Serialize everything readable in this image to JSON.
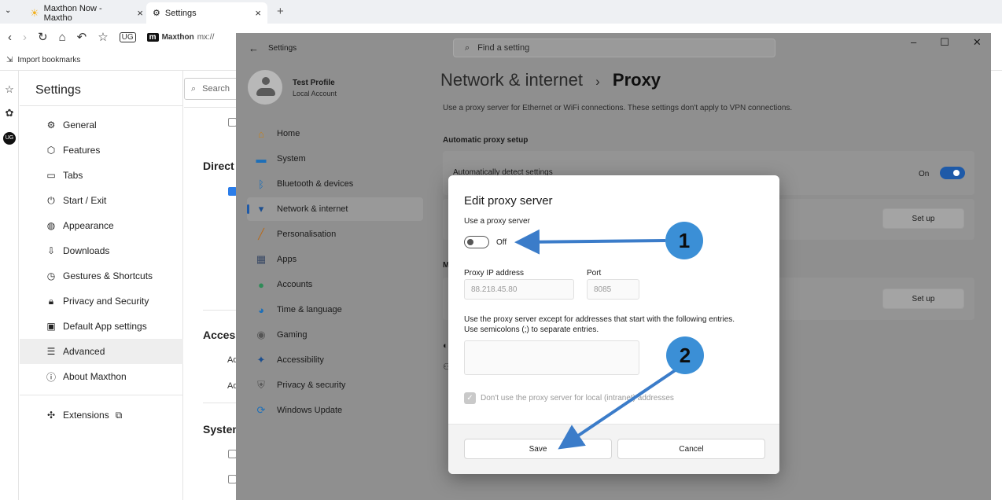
{
  "browser": {
    "tabs": [
      {
        "title": "Maxthon Now - Maxtho",
        "close": "×"
      },
      {
        "title": "Settings",
        "close": "×"
      }
    ],
    "new_tab": "+",
    "address_brand": "Maxthon",
    "address_url": "mx://",
    "bookmarks_import": "Import bookmarks"
  },
  "maxthon": {
    "title": "Settings",
    "search_placeholder": "Search",
    "nav": [
      {
        "label": "General",
        "icon": "gear-icon"
      },
      {
        "label": "Features",
        "icon": "cube-icon"
      },
      {
        "label": "Tabs",
        "icon": "tab-icon"
      },
      {
        "label": "Start / Exit",
        "icon": "power-icon"
      },
      {
        "label": "Appearance",
        "icon": "palette-icon"
      },
      {
        "label": "Downloads",
        "icon": "download-icon"
      },
      {
        "label": "Gestures & Shortcuts",
        "icon": "gesture-icon"
      },
      {
        "label": "Privacy and Security",
        "icon": "lock-icon"
      },
      {
        "label": "Default App settings",
        "icon": "app-icon"
      },
      {
        "label": "Advanced",
        "icon": "sliders-icon"
      },
      {
        "label": "About Maxthon",
        "icon": "info-icon"
      }
    ],
    "extensions_label": "Extensions",
    "main": {
      "heading_direct": "Direct",
      "heading_access": "Access",
      "heading_system": "System",
      "access_row1": "Ad",
      "access_row2": "Ad"
    }
  },
  "windows": {
    "window_title": "Settings",
    "search_placeholder": "Find a setting",
    "profile_name": "Test Profile",
    "profile_sub": "Local Account",
    "nav": [
      {
        "label": "Home",
        "icon": "home-icon"
      },
      {
        "label": "System",
        "icon": "monitor-icon"
      },
      {
        "label": "Bluetooth & devices",
        "icon": "bluetooth-icon"
      },
      {
        "label": "Network & internet",
        "icon": "wifi-icon"
      },
      {
        "label": "Personalisation",
        "icon": "brush-icon"
      },
      {
        "label": "Apps",
        "icon": "apps-icon"
      },
      {
        "label": "Accounts",
        "icon": "person-icon"
      },
      {
        "label": "Time & language",
        "icon": "globe-icon"
      },
      {
        "label": "Gaming",
        "icon": "gamepad-icon"
      },
      {
        "label": "Accessibility",
        "icon": "accessibility-icon"
      },
      {
        "label": "Privacy & security",
        "icon": "shield-icon"
      },
      {
        "label": "Windows Update",
        "icon": "update-icon"
      }
    ],
    "crumb_parent": "Network & internet",
    "crumb_sep": "›",
    "crumb_current": "Proxy",
    "description": "Use a proxy server for Ethernet or WiFi connections. These settings don't apply to VPN connections.",
    "auto_heading": "Automatic proxy setup",
    "auto_detect_label": "Automatically detect settings",
    "auto_detect_state": "On",
    "setup_label_1": "Set up",
    "setup_label_2": "Set up",
    "manual_heading_partial": "M"
  },
  "dialog": {
    "title": "Edit proxy server",
    "use_proxy_label": "Use a proxy server",
    "toggle_state": "Off",
    "ip_label": "Proxy IP address",
    "ip_value": "88.218.45.80",
    "port_label": "Port",
    "port_value": "8085",
    "except_text_1": "Use the proxy server except for addresses that start with the following entries.",
    "except_text_2": "Use semicolons (;) to separate entries.",
    "except_value": "",
    "local_checkbox_label": "Don't use the proxy server for local (intranet) addresses",
    "save_label": "Save",
    "cancel_label": "Cancel"
  },
  "annotations": {
    "badge_1": "1",
    "badge_2": "2",
    "color": "#3b8fd6"
  }
}
